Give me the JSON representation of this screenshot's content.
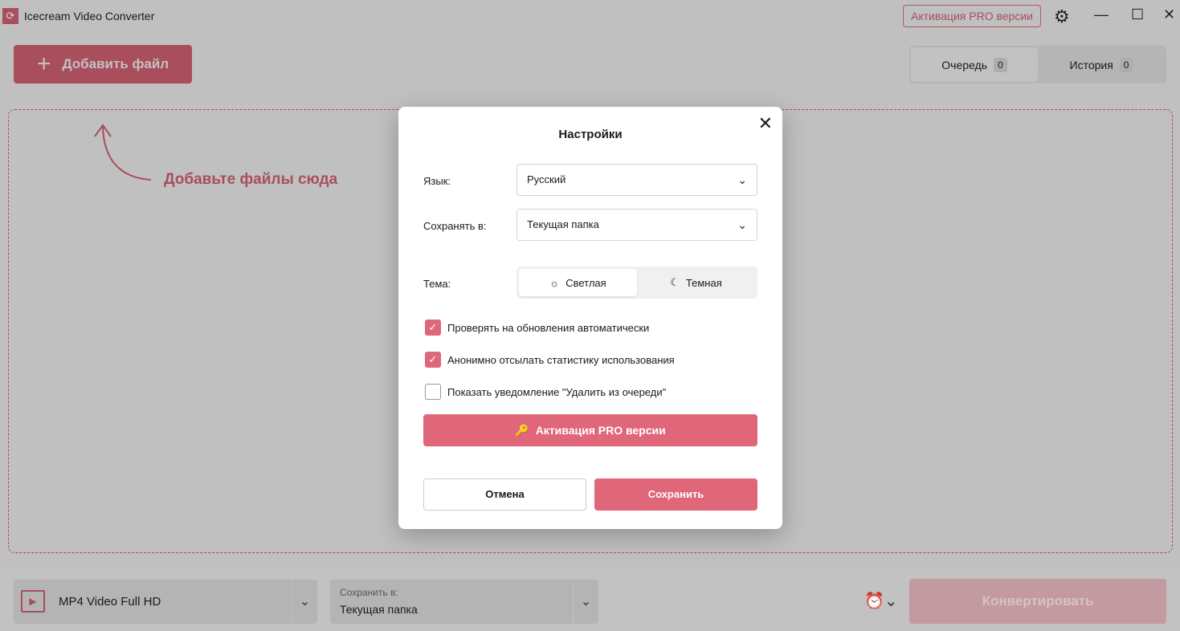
{
  "app": {
    "title": "Icecream Video Converter",
    "pro_button": "Активация PRO версии"
  },
  "toolbar": {
    "add_file": "Добавить файл",
    "tabs": [
      {
        "label": "Очередь",
        "count": "0"
      },
      {
        "label": "История",
        "count": "0"
      }
    ]
  },
  "dropzone": {
    "hint": "Добавьте файлы сюда"
  },
  "bottom": {
    "format": "MP4 Video Full HD",
    "save_label": "Сохранить в:",
    "save_value": "Текущая папка",
    "convert": "Конвертировать"
  },
  "settings": {
    "title": "Настройки",
    "language_label": "Язык:",
    "language_value": "Русский",
    "save_label": "Сохранять в:",
    "save_value": "Текущая папка",
    "theme_label": "Тема:",
    "theme_light": "Светлая",
    "theme_dark": "Темная",
    "checkboxes": [
      {
        "label": "Проверять на обновления автоматически",
        "checked": true
      },
      {
        "label": "Анонимно отсылать статистику использования",
        "checked": true
      },
      {
        "label": "Показать уведомление \"Удалить из очереди\"",
        "checked": false
      }
    ],
    "pro_button": "Активация PRO версии",
    "cancel": "Отмена",
    "save": "Сохранить"
  },
  "colors": {
    "accent": "#e0667a",
    "overlay": "#c0c0c0"
  }
}
